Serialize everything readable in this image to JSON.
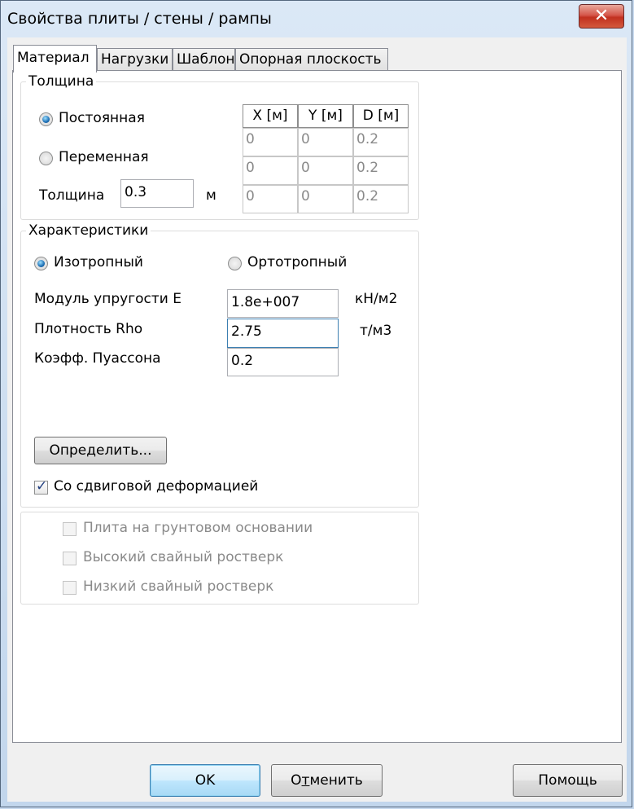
{
  "window": {
    "title": "Свойства плиты / стены  /  рампы",
    "close_label": "✕"
  },
  "tabs": [
    {
      "label": "Материал"
    },
    {
      "label": "Нагрузки"
    },
    {
      "label": "Шаблон"
    },
    {
      "label": "Опорная плоскость"
    }
  ],
  "thickness": {
    "legend": "Толщина",
    "constant_label": "Постоянная",
    "variable_label": "Переменная",
    "selected": "constant",
    "thickness_label": "Толщина",
    "thickness_value": "0.3",
    "unit": "м",
    "grid": {
      "headers": [
        "X [м]",
        "Y [м]",
        "D [м]"
      ],
      "rows": [
        [
          "0",
          "0",
          "0.2"
        ],
        [
          "0",
          "0",
          "0.2"
        ],
        [
          "0",
          "0",
          "0.2"
        ]
      ]
    }
  },
  "characteristics": {
    "legend": "Характеристики",
    "isotropic_label": "Изотропный",
    "orthotropic_label": "Ортотропный",
    "selected": "isotropic",
    "modulus_label": "Модуль упругости E",
    "modulus_value": "1.8e+007",
    "modulus_unit": "кН/м2",
    "density_label": "Плотность Rho",
    "density_value": "2.75",
    "density_unit": "т/м3",
    "poisson_label": "Коэфф. Пуассона",
    "poisson_value": "0.2",
    "define_button": "Определить...",
    "shear_label": "Со сдвиговой деформацией",
    "shear_checked": true
  },
  "foundation": {
    "ground_label": "Плита на грунтовом основании",
    "high_pile_label": "Высокий свайный ростверк",
    "low_pile_label": "Низкий свайный ростверк"
  },
  "buttons": {
    "ok": "OK",
    "cancel_pre": "О",
    "cancel_underline": "т",
    "cancel_post": "менить",
    "help": "Помощь"
  }
}
